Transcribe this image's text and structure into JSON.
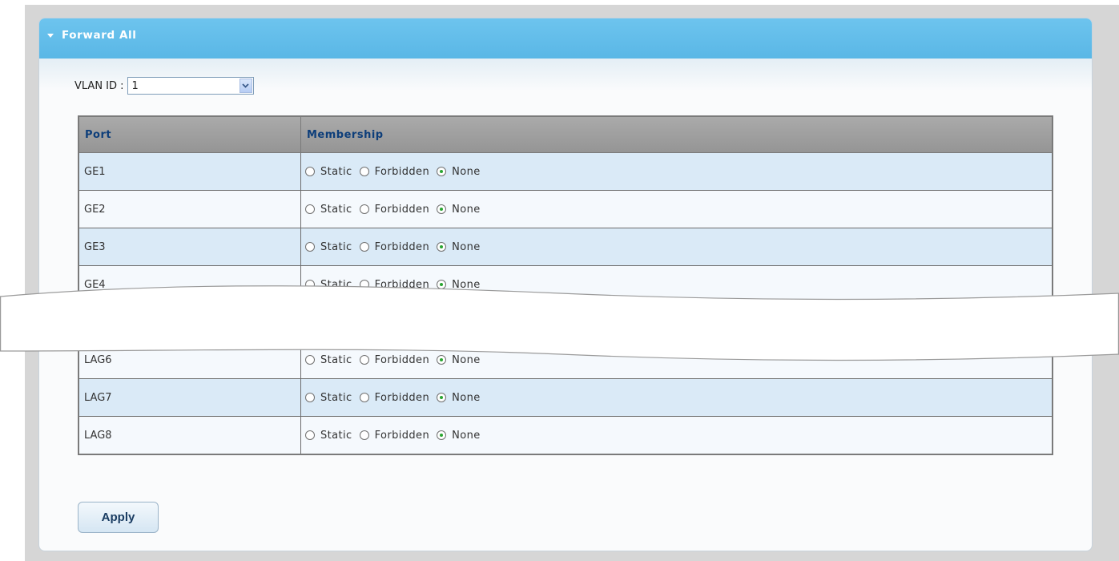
{
  "panel": {
    "title": "Forward All"
  },
  "vlan": {
    "label": "VLAN ID :",
    "selected": "1"
  },
  "table": {
    "headers": {
      "port": "Port",
      "membership": "Membership"
    },
    "options": {
      "static": "Static",
      "forbidden": "Forbidden",
      "none": "None"
    },
    "rows": [
      {
        "port": "GE1",
        "selected": "None"
      },
      {
        "port": "GE2",
        "selected": "None"
      },
      {
        "port": "GE3",
        "selected": "None"
      },
      {
        "port": "GE4",
        "selected": "None"
      },
      {
        "port": "",
        "selected": "None"
      },
      {
        "port": "LAG6",
        "selected": "None"
      },
      {
        "port": "LAG7",
        "selected": "None"
      },
      {
        "port": "LAG8",
        "selected": "None"
      }
    ]
  },
  "buttons": {
    "apply": "Apply"
  },
  "colors": {
    "header_blue": "#5ab7e6",
    "row_blue": "#daeaf7",
    "radio_green": "#2aa532"
  }
}
